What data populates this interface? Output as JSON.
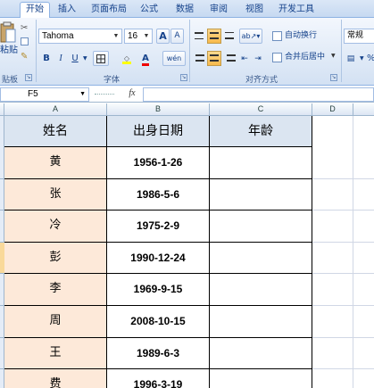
{
  "tabs": [
    "开始",
    "插入",
    "页面布局",
    "公式",
    "数据",
    "审阅",
    "视图",
    "开发工具"
  ],
  "ribbon": {
    "paste_label": "粘贴",
    "clipboard_label": "贴板",
    "font_name": "Tahoma",
    "font_size": "16",
    "grow_font": "A",
    "shrink_font": "A",
    "bold": "B",
    "italic": "I",
    "underline": "U",
    "font_color_letter": "A",
    "phonetic": "wén",
    "font_group_label": "字体",
    "wrap_text": "自动换行",
    "merge_center": "合并后居中",
    "alignment_group_label": "对齐方式",
    "number_format": "常规",
    "percent": "%"
  },
  "formula_bar": {
    "name_box": "F5",
    "fx": "fx"
  },
  "columns": [
    "A",
    "B",
    "C",
    "D"
  ],
  "table": {
    "headers": [
      "姓名",
      "出身日期",
      "年龄"
    ],
    "rows": [
      {
        "name": "黄",
        "date": "1956-1-26",
        "age": ""
      },
      {
        "name": "张",
        "date": "1986-5-6",
        "age": ""
      },
      {
        "name": "冷",
        "date": "1975-2-9",
        "age": ""
      },
      {
        "name": "彭",
        "date": "1990-12-24",
        "age": ""
      },
      {
        "name": "李",
        "date": "1969-9-15",
        "age": ""
      },
      {
        "name": "周",
        "date": "2008-10-15",
        "age": ""
      },
      {
        "name": "王",
        "date": "1989-6-3",
        "age": ""
      },
      {
        "name": "费",
        "date": "1996-3-19",
        "age": ""
      }
    ]
  },
  "colors": {
    "header_fill": "#dbe5f1",
    "name_fill": "#fde9d9",
    "ribbon_accent": "#15428b"
  }
}
